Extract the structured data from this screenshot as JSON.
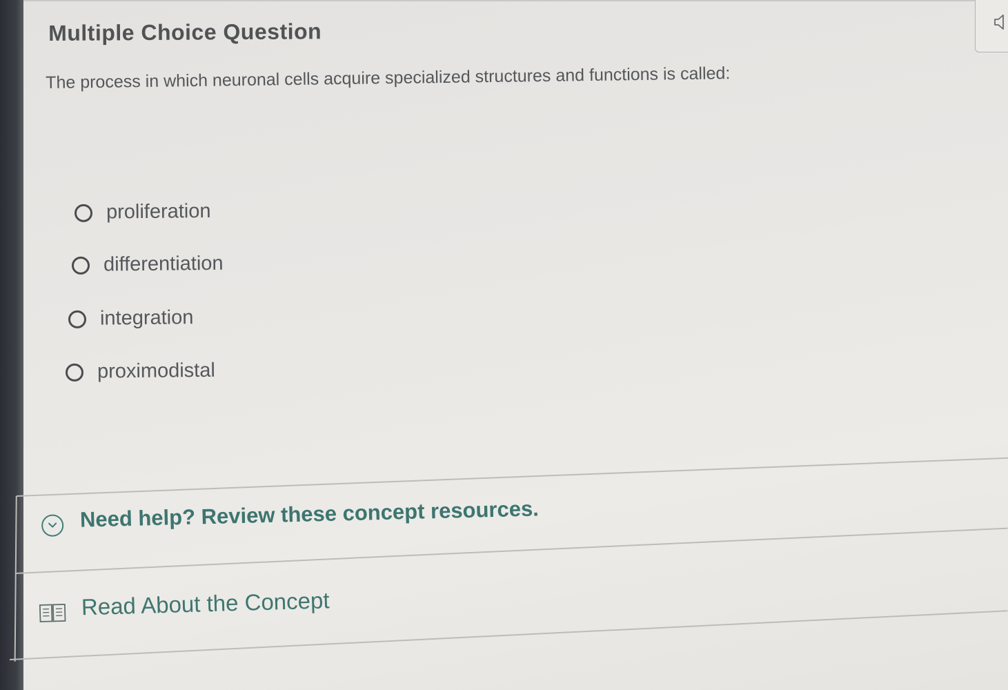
{
  "question": {
    "heading": "Multiple Choice Question",
    "prompt": "The process in which neuronal cells acquire specialized structures and functions is called:",
    "options": [
      {
        "label": "proliferation",
        "selected": false
      },
      {
        "label": "differentiation",
        "selected": false
      },
      {
        "label": "integration",
        "selected": false
      },
      {
        "label": "proximodistal",
        "selected": false
      }
    ]
  },
  "help": {
    "toggle_label": "Need help? Review these concept resources.",
    "resources": [
      {
        "label": "Read About the Concept",
        "icon": "book-icon"
      }
    ]
  },
  "toolbar": {
    "audio_icon": "speaker-icon"
  },
  "colors": {
    "accent": "#3d7570",
    "text": "#54575a",
    "background": "#e9e7e4"
  }
}
